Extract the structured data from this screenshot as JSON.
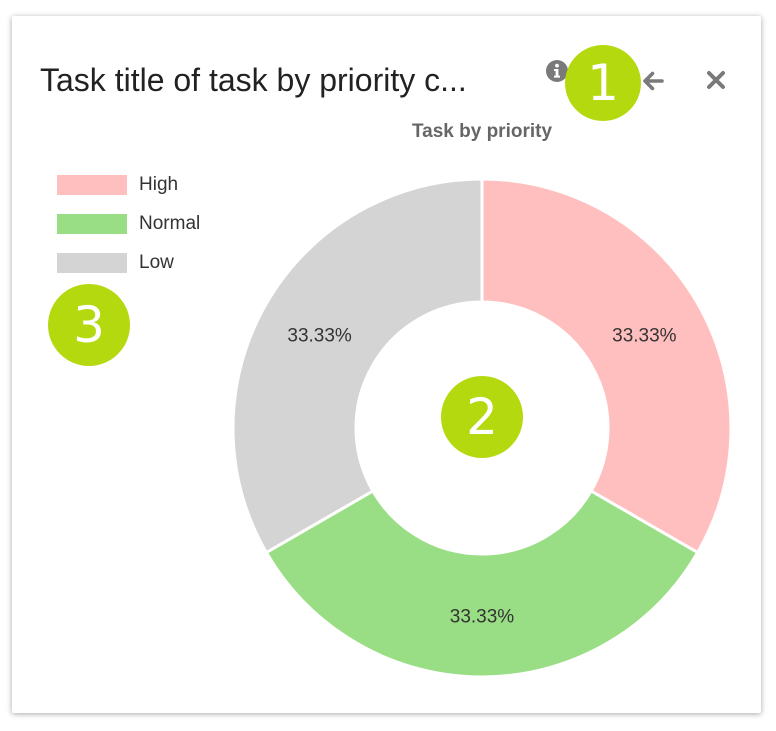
{
  "card": {
    "title": "Task title of task by priority c...",
    "info_icon": "info-icon",
    "back_icon": "arrow-left-icon",
    "close_icon": "close-icon"
  },
  "callouts": {
    "one": "1",
    "two": "2",
    "three": "3"
  },
  "colors": {
    "callout": "#b5d90f",
    "icon": "#7a7a7a"
  },
  "chart_data": {
    "type": "pie",
    "donut": true,
    "title": "Task by priority",
    "legend_position": "top-left",
    "categories": [
      "High",
      "Normal",
      "Low"
    ],
    "values": [
      33.33,
      33.33,
      33.33
    ],
    "labels": [
      "33.33%",
      "33.33%",
      "33.33%"
    ],
    "colors": [
      "#ffbfbf",
      "#99de84",
      "#d4d4d4"
    ]
  }
}
